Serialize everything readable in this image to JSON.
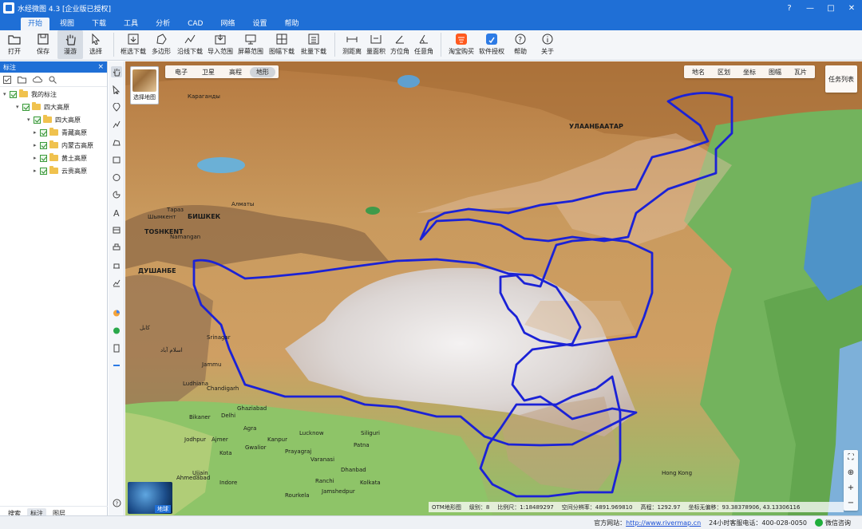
{
  "window": {
    "title": "水经微图 4.3 [企业版已授权]",
    "controls": [
      "?",
      "—",
      "□",
      "✕"
    ]
  },
  "menu": [
    "开始",
    "视图",
    "下载",
    "工具",
    "分析",
    "CAD",
    "网络",
    "设置",
    "帮助"
  ],
  "ribbon": {
    "open": "打开",
    "save": "保存",
    "roam": "漫游",
    "select": "选择",
    "box_download": "框选下载",
    "polygon": "多边形",
    "line_download": "沿线下载",
    "import_range": "导入范围",
    "screen_range": "屏幕范围",
    "sheet_download": "图幅下载",
    "batch_download": "批量下载",
    "measure_distance": "测距离",
    "measure_area": "量面积",
    "azimuth": "方位角",
    "any_angle": "任意角",
    "taobao": "淘宝购买",
    "license": "软件授权",
    "help": "帮助",
    "about": "关于"
  },
  "left_panel": {
    "title": "标注",
    "close": "×",
    "tree": {
      "root": "我的标注",
      "group": "四大高原",
      "subgroup": "四大高原",
      "items": [
        "青藏高原",
        "内蒙古高原",
        "黄土高原",
        "云贵高原"
      ]
    },
    "tabs": [
      "搜索",
      "标注",
      "图层"
    ]
  },
  "map": {
    "select_map": "选择地图",
    "map_types": [
      "电子",
      "卫星",
      "高程",
      "地形"
    ],
    "active_type": "地形",
    "tools": [
      "地名",
      "区划",
      "坐标",
      "图幅",
      "瓦片"
    ],
    "task_list": "任务列表",
    "globe_label": "地球",
    "labels": {
      "ulaanbaatar": "УЛААНБААТАР",
      "bishkek": "БИШКЕК",
      "almaty": "Алматы",
      "tashkent": "TOSHKENT",
      "dushanbe": "ДУШАНБЕ",
      "shymkent": "Шымкент",
      "taraz": "Тараз",
      "karaganda": "Караганды",
      "namangan": "Namangan",
      "kabul": "کابل",
      "islamabad": "اسلام آباد",
      "srinagar": "Srinagar",
      "jammu": "Jammu",
      "ludhiana": "Ludhiana",
      "chandigarh": "Chandigarh",
      "ghaziabad": "Ghaziabad",
      "delhi": "Delhi",
      "lucknow": "Lucknow",
      "agra": "Agra",
      "gwalior": "Gwalior",
      "jodhpur": "Jodhpur",
      "ajmer": "Ajmer",
      "kota": "Kota",
      "ujjain": "Ujjain",
      "indore": "Indore",
      "ahmedabad": "Ahmedabad",
      "varanasi": "Varanasi",
      "prayagraj": "Prayagraj",
      "patna": "Patna",
      "kanpur": "Kanpur",
      "bikaner": "Bikaner",
      "hong_kong": "Hong Kong",
      "siliguri": "Siliguri",
      "ranchi": "Ranchi",
      "dhanbad": "Dhanbad",
      "kolkata": "Kolkata",
      "jamshedpur": "Jamshedpur",
      "rourkela": "Rourkela"
    },
    "status": {
      "source": "OTM地形图",
      "level_label": "级别：",
      "level": "8",
      "scale_label": "比例尺：",
      "scale": "1:18489297",
      "resolution_label": "空间分辨率：",
      "resolution": "4891.969810",
      "elevation_label": "高程：",
      "elevation": "1292.97",
      "coord_label": "坐标无偏移：",
      "coord": "93.38378906, 43.13306116"
    }
  },
  "statusbar": {
    "website_label": "官方网站：",
    "website": "http://www.rivermap.cn",
    "phone_label": "24小时客服电话：",
    "phone": "400-028-0050",
    "wechat": "微信咨询"
  }
}
